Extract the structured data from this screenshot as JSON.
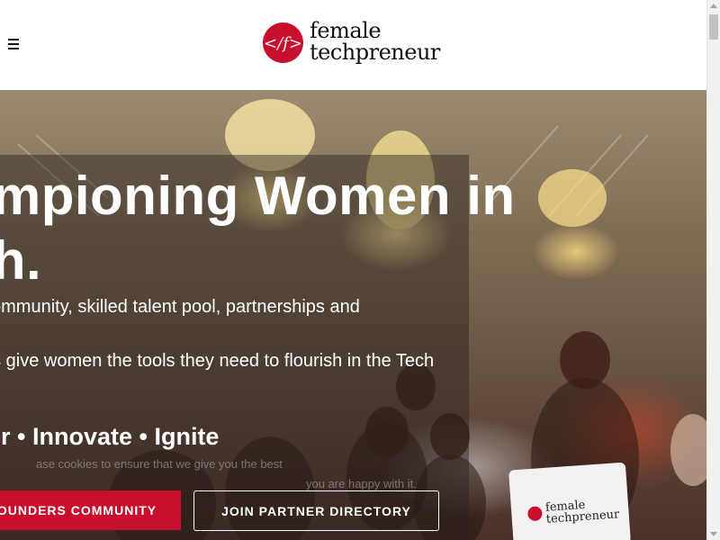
{
  "header": {
    "menu_icon": "hamburger-menu-icon",
    "logo": {
      "line1": "female",
      "line2": "techpreneur",
      "mark_glyph": "</f>",
      "brand_color": "#c8102e"
    }
  },
  "hero": {
    "title_line1": "ampioning Women in",
    "title_line2": "ch.",
    "description_lines": [
      " community, skilled talent pool, partnerships and",
      "",
      "es give women the tools they need to flourish in the Tech"
    ],
    "tagline": "wer • Innovate • Ignite",
    "cookie_text_1": "ase cookies to ensure that we give you the best",
    "cookie_text_2": "you are happy with it.",
    "primary_button": "OUNDERS COMMUNITY",
    "secondary_button": "JOIN PARTNER DIRECTORY",
    "pillow_text_line1": "female",
    "pillow_text_line2": "techpreneur"
  },
  "colors": {
    "accent": "#c8102e",
    "text_on_hero": "#ffffff"
  }
}
